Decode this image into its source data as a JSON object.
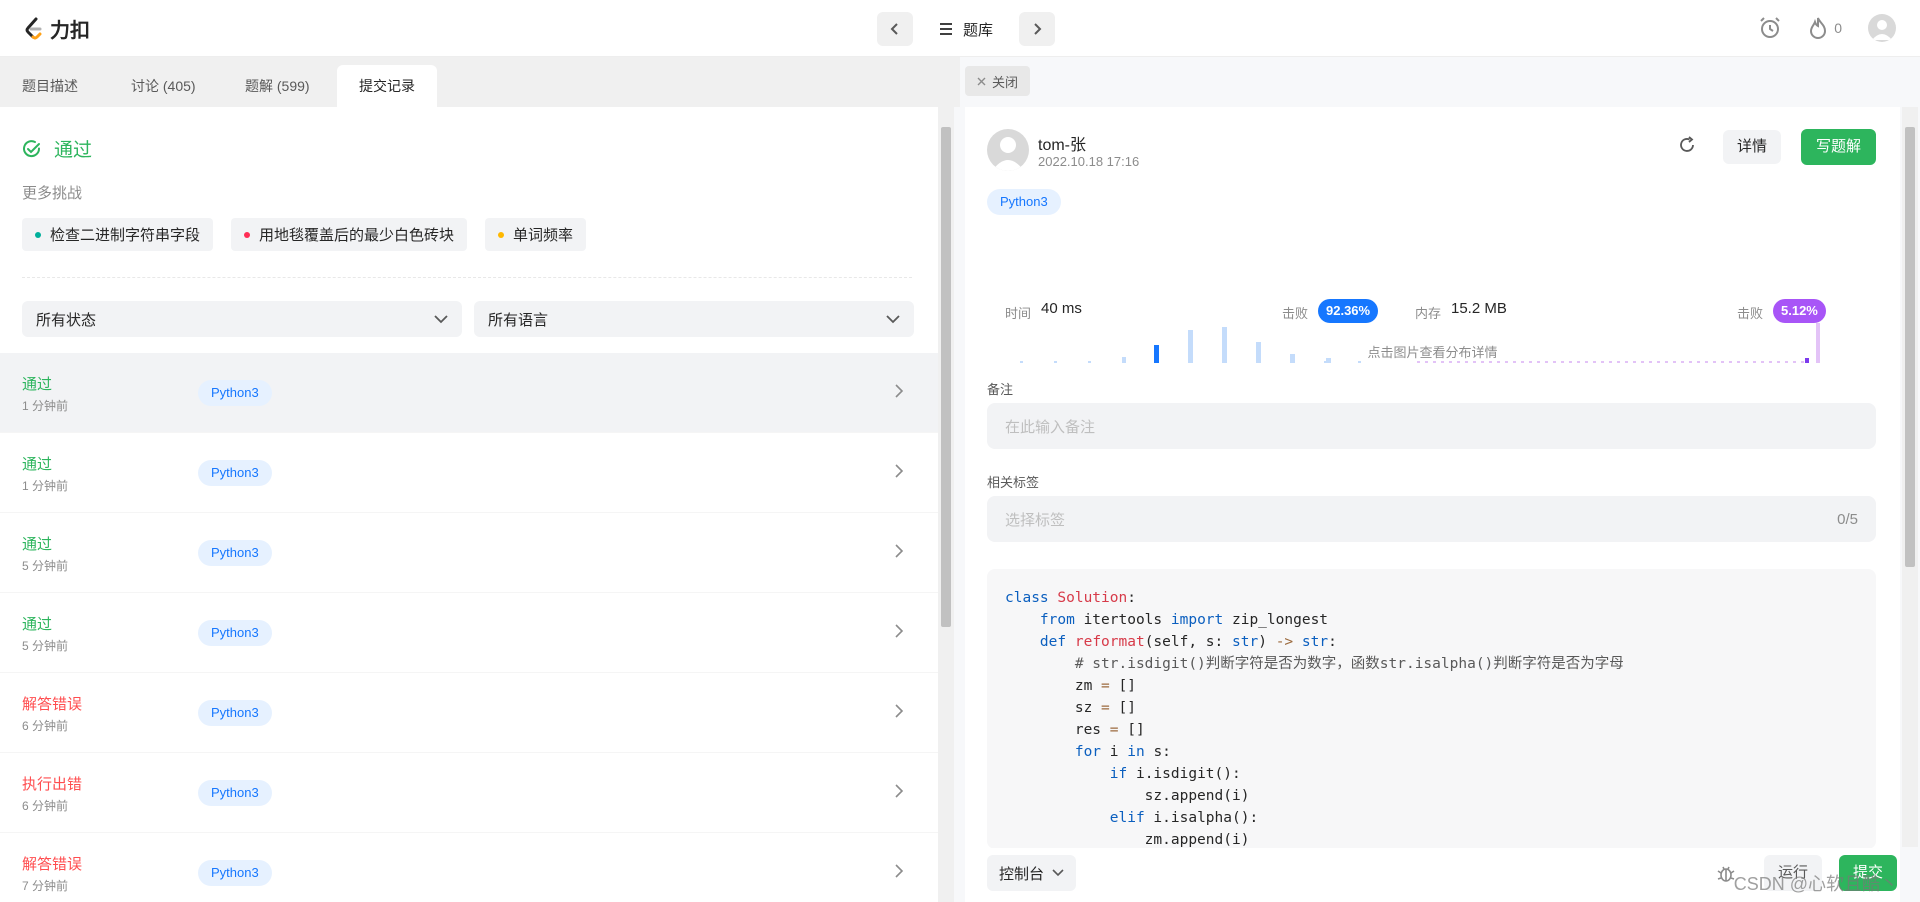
{
  "nav": {
    "logo_text": "力扣",
    "bank_label": "题库",
    "fire_count": "0"
  },
  "left_tabs": [
    {
      "label": "题目描述"
    },
    {
      "label": "讨论 (405)"
    },
    {
      "label": "题解 (599)"
    },
    {
      "label": "提交记录"
    }
  ],
  "result": {
    "status": "通过",
    "more_title": "更多挑战"
  },
  "challenges": [
    {
      "label": "检查二进制字符串字段",
      "color": "#00af9b"
    },
    {
      "label": "用地毯覆盖后的最少白色砖块",
      "color": "#ff2d55"
    },
    {
      "label": "单词频率",
      "color": "#ffb800"
    }
  ],
  "filters": {
    "status": "所有状态",
    "language": "所有语言"
  },
  "submissions": [
    {
      "status": "通过",
      "time": "1 分钟前",
      "lang": "Python3",
      "color": "#2db55d"
    },
    {
      "status": "通过",
      "time": "1 分钟前",
      "lang": "Python3",
      "color": "#2db55d"
    },
    {
      "status": "通过",
      "time": "5 分钟前",
      "lang": "Python3",
      "color": "#2db55d"
    },
    {
      "status": "通过",
      "time": "5 分钟前",
      "lang": "Python3",
      "color": "#2db55d"
    },
    {
      "status": "解答错误",
      "time": "6 分钟前",
      "lang": "Python3",
      "color": "#ff4d4f"
    },
    {
      "status": "执行出错",
      "time": "6 分钟前",
      "lang": "Python3",
      "color": "#ff4d4f"
    },
    {
      "status": "解答错误",
      "time": "7 分钟前",
      "lang": "Python3",
      "color": "#ff4d4f"
    }
  ],
  "detail": {
    "close_label": "关闭",
    "user": "tom-张",
    "date": "2022.10.18 17:16",
    "detail_btn": "详情",
    "write_btn": "写题解",
    "lang": "Python3",
    "time_label": "时间",
    "time_value": "40 ms",
    "beat_label": "击败",
    "time_beat": "92.36%",
    "mem_label": "内存",
    "mem_value": "15.2 MB",
    "mem_beat": "5.12%",
    "chart_hint": "点击图片查看分布详情",
    "note_label": "备注",
    "note_placeholder": "在此输入备注",
    "tags_label": "相关标签",
    "tags_placeholder": "选择标签",
    "tags_count": "0/5"
  },
  "bottom": {
    "console": "控制台",
    "run": "运行",
    "submit": "提交"
  },
  "watermark": "CSDN @心软且酷丶",
  "colors": {
    "accent_green": "#2db55d",
    "accent_blue": "#1677ff",
    "accent_purple": "#a855f7"
  }
}
